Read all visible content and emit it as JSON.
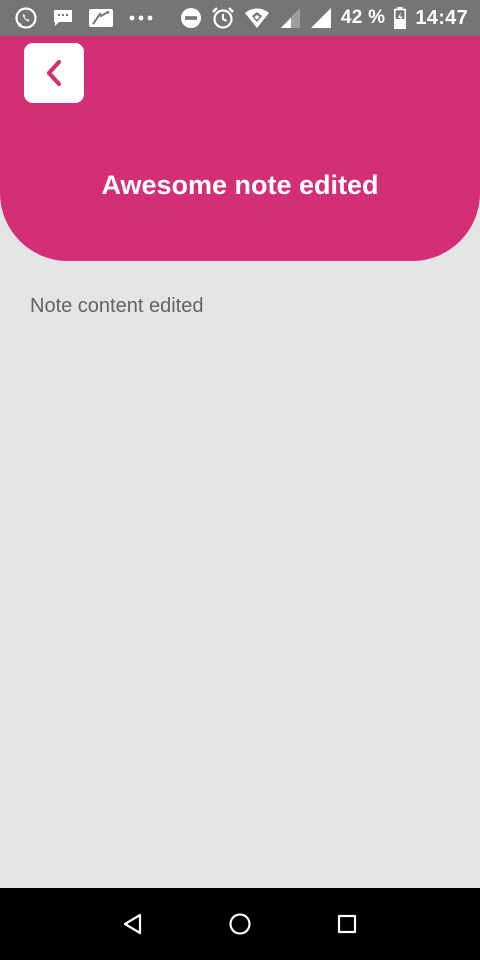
{
  "status_bar": {
    "left_icons": [
      "whatsapp-icon",
      "message-icon",
      "gallery-icon",
      "more-dots-icon"
    ],
    "right_icons": [
      "do-not-disturb-icon",
      "alarm-icon",
      "wifi-icon",
      "signal-icon",
      "battery-icon"
    ],
    "battery_percent": "42 %",
    "time": "14:47"
  },
  "header": {
    "back_icon": "chevron-left-icon",
    "title": "Awesome note edited",
    "background_color": "#d32f77"
  },
  "note": {
    "content": "Note content edited"
  },
  "nav_bar": {
    "buttons": [
      "back-triangle-icon",
      "home-circle-icon",
      "recents-square-icon"
    ]
  }
}
